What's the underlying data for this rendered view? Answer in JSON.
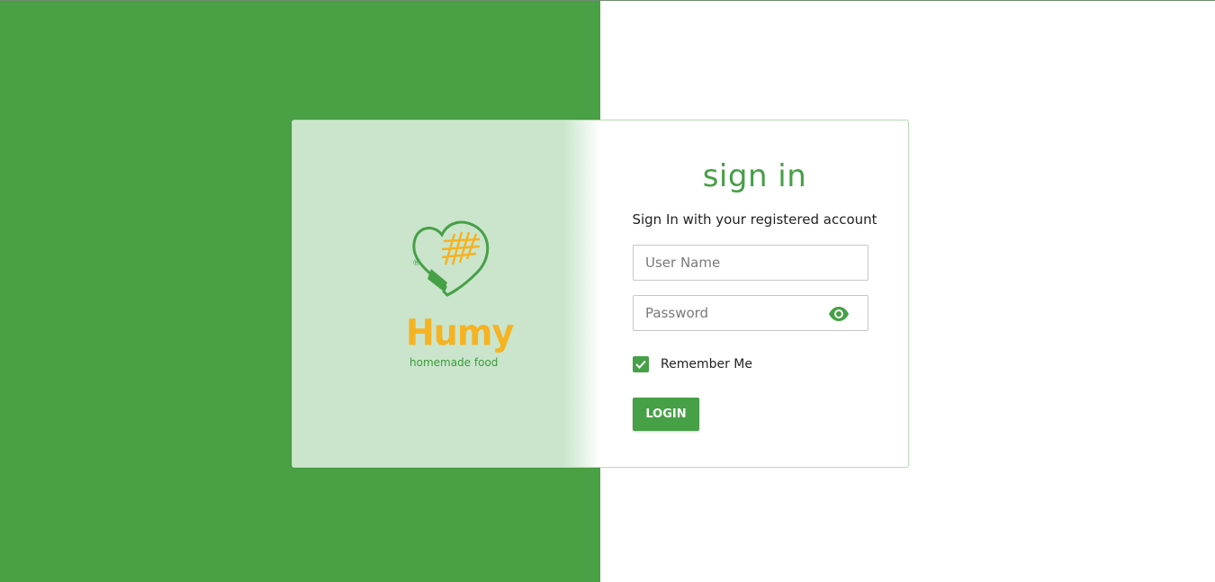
{
  "brand": {
    "name": "Humy",
    "tagline": "homemade food",
    "logo_icon": "oven-mitt-heart-icon",
    "registered_mark": "®"
  },
  "signin": {
    "title": "sign in",
    "subtitle": "Sign In with your registered account",
    "username": {
      "placeholder": "User Name",
      "value": ""
    },
    "password": {
      "placeholder": "Password",
      "value": "",
      "toggle_icon": "eye-icon"
    },
    "remember": {
      "label": "Remember Me",
      "checked": true
    },
    "login_label": "LOGIN"
  },
  "colors": {
    "primary_green": "#4aa045",
    "panel_green": "#cae5cb",
    "logo_yellow": "#f5b323"
  }
}
